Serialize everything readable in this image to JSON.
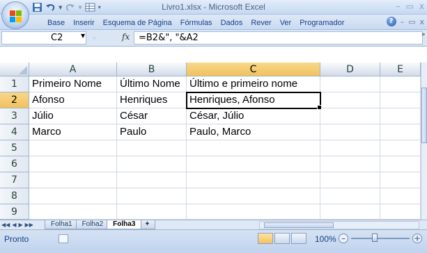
{
  "window": {
    "title": "Livro1.xlsx - Microsoft Excel",
    "controls": [
      "–",
      "▭",
      "x"
    ]
  },
  "ribbon": {
    "tabs": [
      "Base",
      "Inserir",
      "Esquema de Página",
      "Fórmulas",
      "Dados",
      "Rever",
      "Ver",
      "Programador"
    ]
  },
  "formula_bar": {
    "name_box": "C2",
    "fx_label": "fx",
    "formula": "=B2&\", \"&A2"
  },
  "sheet": {
    "columns": [
      "A",
      "B",
      "C",
      "D",
      "E"
    ],
    "rows": [
      "1",
      "2",
      "3",
      "4",
      "5",
      "6",
      "7",
      "8",
      "9"
    ],
    "cells": [
      [
        "Primeiro Nome",
        "Último Nome",
        "Último e primeiro nome",
        "",
        ""
      ],
      [
        "Afonso",
        "Henriques",
        "Henriques, Afonso",
        "",
        ""
      ],
      [
        "Júlio",
        "César",
        "César, Júlio",
        "",
        ""
      ],
      [
        "Marco",
        "Paulo",
        "Paulo, Marco",
        "",
        ""
      ],
      [
        "",
        "",
        "",
        "",
        ""
      ],
      [
        "",
        "",
        "",
        "",
        ""
      ],
      [
        "",
        "",
        "",
        "",
        ""
      ],
      [
        "",
        "",
        "",
        "",
        ""
      ],
      [
        "",
        "",
        "",
        "",
        ""
      ]
    ],
    "active_cell": "C2"
  },
  "sheet_tabs": {
    "tabs": [
      "Folha1",
      "Folha2",
      "Folha3"
    ],
    "active": "Folha3"
  },
  "status_bar": {
    "status": "Pronto",
    "zoom": "100%"
  },
  "colors": {
    "selected_header": "#f1c15f",
    "ribbon_text": "#15428b"
  }
}
